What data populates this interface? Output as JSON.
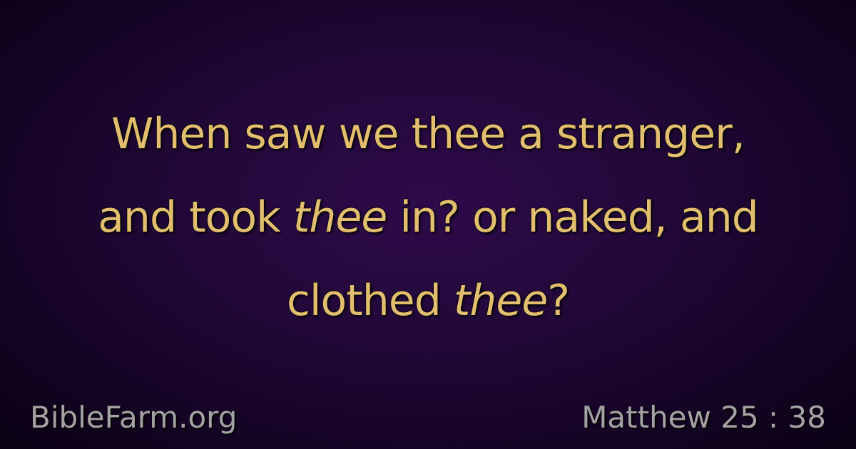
{
  "verse": {
    "line1": "When saw we thee a stranger,",
    "line2_a": "and took ",
    "line2_italic": "thee",
    "line2_b": " in? or naked, and",
    "line3_a": "clothed ",
    "line3_italic": "thee",
    "line3_b": "?"
  },
  "footer": {
    "site": "BibleFarm.org",
    "reference": "Matthew 25 : 38"
  },
  "colors": {
    "verse_text": "#e2bf6e",
    "footer_text": "#a3a3a3",
    "background": "#220838"
  }
}
